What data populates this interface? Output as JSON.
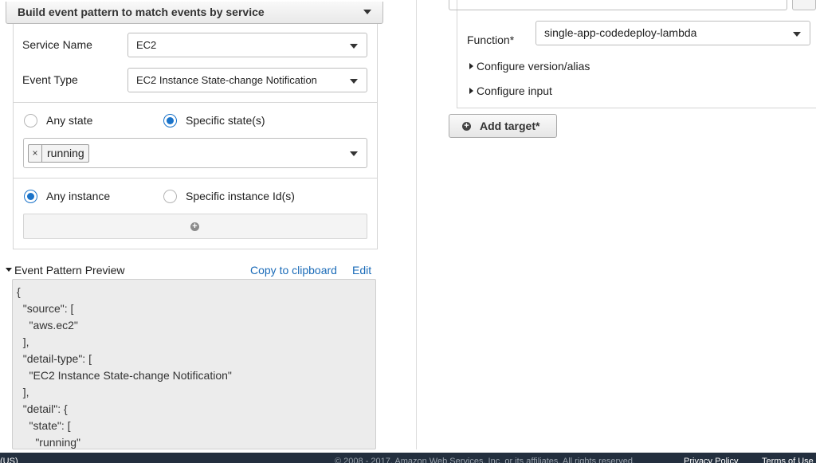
{
  "event_source": {
    "pattern_mode": "Build event pattern to match events by service",
    "service_name_label": "Service Name",
    "service_name_value": "EC2",
    "event_type_label": "Event Type",
    "event_type_value": "EC2 Instance State-change Notification",
    "state_options": {
      "any_state": "Any state",
      "specific_states": "Specific state(s)",
      "selected": "specific_states"
    },
    "selected_states": [
      "running"
    ],
    "instance_options": {
      "any_instance": "Any instance",
      "specific_instance_ids": "Specific instance Id(s)",
      "selected": "any_instance"
    }
  },
  "preview": {
    "title": "Event Pattern Preview",
    "copy_link": "Copy to clipboard",
    "edit_link": "Edit",
    "code_lines": [
      "{",
      "  \"source\": [",
      "    \"aws.ec2\"",
      "  ],",
      "  \"detail-type\": [",
      "    \"EC2 Instance State-change Notification\"",
      "  ],",
      "  \"detail\": {",
      "    \"state\": [",
      "      \"running\""
    ]
  },
  "targets": {
    "function_label": "Function*",
    "function_value": "single-app-codedeploy-lambda",
    "configure_version": "Configure version/alias",
    "configure_input": "Configure input",
    "add_target_label": "Add target*"
  },
  "footer": {
    "left_text": "(US)",
    "copyright": "© 2008 - 2017, Amazon Web Services, Inc. or its affiliates. All rights reserved.",
    "privacy": "Privacy Policy",
    "terms": "Terms of Use"
  },
  "colors": {
    "link": "#1a6bb8",
    "radio_selected": "#1a73c9",
    "footer_bg": "#232f3e",
    "preview_bg": "#ececec"
  }
}
